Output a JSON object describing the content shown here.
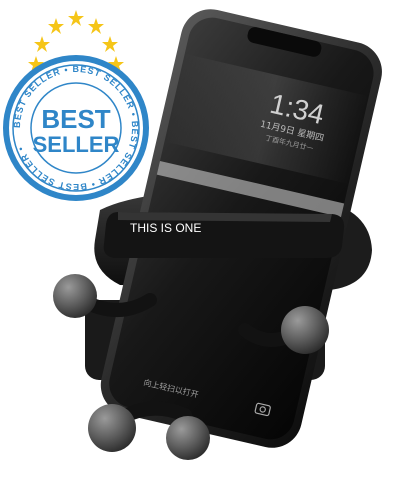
{
  "badge": {
    "ring_text": "BEST SELLER • BEST SELLER • BEST SELLER • BEST SELLER • ",
    "line1": "BEST",
    "line2": "SELLER",
    "star_color": "#F5C518",
    "badge_color": "#2F86C8"
  },
  "phone": {
    "time": "1:34",
    "date": "11月9日 星期四",
    "lunar": "丁酉年九月廿一",
    "unlock_hint": "向上轻扫以打开"
  },
  "holder": {
    "label": "THIS IS ONE"
  }
}
